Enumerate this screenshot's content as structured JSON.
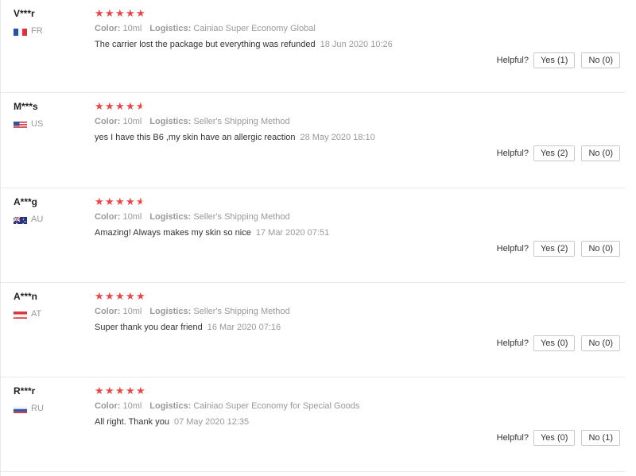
{
  "reviews": [
    {
      "user": "V***r",
      "country": "FR",
      "rating": 5,
      "color_label": "Color:",
      "color_value": "10ml",
      "logistics_label": "Logistics:",
      "logistics_value": "Cainiao Super Economy Global",
      "text": "The carrier lost the package but everything was refunded",
      "date": "18 Jun 2020 10:26",
      "helpful_label": "Helpful?",
      "yes_label": "Yes (1)",
      "no_label": "No (0)"
    },
    {
      "user": "M***s",
      "country": "US",
      "rating": 4.5,
      "color_label": "Color:",
      "color_value": "10ml",
      "logistics_label": "Logistics:",
      "logistics_value": "Seller's Shipping Method",
      "text": "yes I have this B6 ,my skin have an allergic reaction",
      "date": "28 May 2020 18:10",
      "helpful_label": "Helpful?",
      "yes_label": "Yes (2)",
      "no_label": "No (0)"
    },
    {
      "user": "A***g",
      "country": "AU",
      "rating": 4.5,
      "color_label": "Color:",
      "color_value": "10ml",
      "logistics_label": "Logistics:",
      "logistics_value": "Seller's Shipping Method",
      "text": "Amazing! Always makes my skin so nice",
      "date": "17 Mar 2020 07:51",
      "helpful_label": "Helpful?",
      "yes_label": "Yes (2)",
      "no_label": "No (0)"
    },
    {
      "user": "A***n",
      "country": "AT",
      "rating": 5,
      "color_label": "Color:",
      "color_value": "10ml",
      "logistics_label": "Logistics:",
      "logistics_value": "Seller's Shipping Method",
      "text": "Super thank you dear friend",
      "date": "16 Mar 2020 07:16",
      "helpful_label": "Helpful?",
      "yes_label": "Yes (0)",
      "no_label": "No (0)"
    },
    {
      "user": "R***r",
      "country": "RU",
      "rating": 5,
      "color_label": "Color:",
      "color_value": "10ml",
      "logistics_label": "Logistics:",
      "logistics_value": "Cainiao Super Economy for Special Goods",
      "text": "All right. Thank you",
      "date": "07 May 2020 12:35",
      "helpful_label": "Helpful?",
      "yes_label": "Yes (0)",
      "no_label": "No (1)"
    }
  ],
  "colors": {
    "star": "#ee4444",
    "muted": "#999999",
    "border": "#e8e8e8"
  },
  "icons": {
    "star": "star-icon",
    "flag": "country-flag-icon"
  }
}
